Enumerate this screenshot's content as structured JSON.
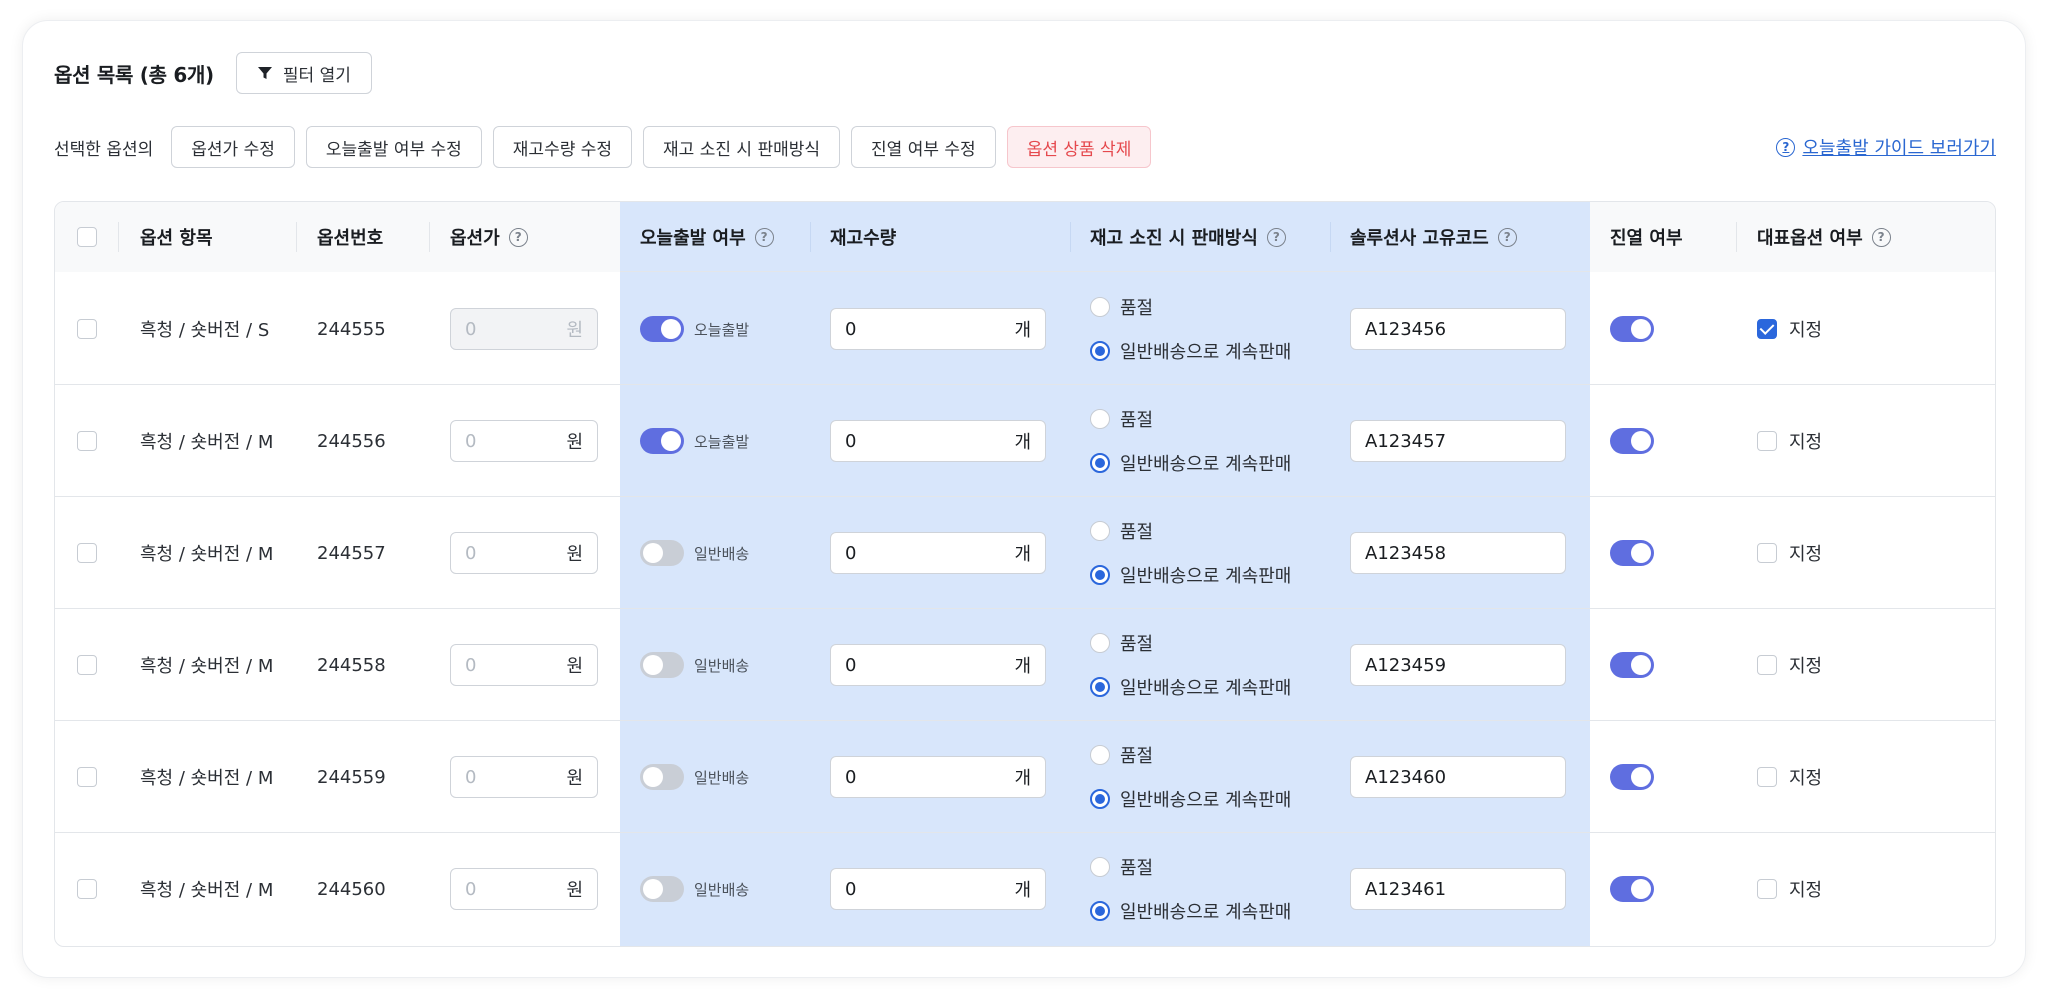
{
  "header": {
    "title": "옵션 목록 (총 6개)",
    "filter_button": "필터 열기",
    "filter_icon": "filter-icon"
  },
  "actions": {
    "label": "선택한 옵션의",
    "buttons": [
      "옵션가 수정",
      "오늘출발 여부 수정",
      "재고수량 수정",
      "재고 소진 시 판매방식",
      "진열 여부 수정"
    ],
    "delete_button": "옵션 상품 삭제",
    "guide_link": "오늘출발 가이드 보러가기",
    "guide_icon": "help-circle-icon"
  },
  "colors": {
    "accent": "#2b67dc",
    "toggle_on": "#5f6ee0",
    "highlight": "#d8e6fb",
    "danger": "#e5484d"
  },
  "columns": {
    "item": "옵션 항목",
    "number": "옵션번호",
    "price": "옵션가",
    "today": "오늘출발 여부",
    "stock": "재고수량",
    "soldout_mode": "재고 소진 시 판매방식",
    "code": "솔루션사 고유코드",
    "display": "진열 여부",
    "representative": "대표옵션 여부"
  },
  "labels": {
    "price_placeholder": "0",
    "price_unit": "원",
    "stock_unit": "개",
    "soldout": "품절",
    "continue": "일반배송으로 계속판매",
    "rep": "지정"
  },
  "rows": [
    {
      "item": "흑청 / 숏버전 / S",
      "number": "244555",
      "price_disabled": true,
      "today_on": true,
      "today_label": "오늘출발",
      "stock": "0",
      "mode": "continue",
      "code": "A123456",
      "display_on": true,
      "rep_checked": true
    },
    {
      "item": "흑청 / 숏버전 / M",
      "number": "244556",
      "price_disabled": false,
      "today_on": true,
      "today_label": "오늘출발",
      "stock": "0",
      "mode": "continue",
      "code": "A123457",
      "display_on": true,
      "rep_checked": false
    },
    {
      "item": "흑청 / 숏버전 / M",
      "number": "244557",
      "price_disabled": false,
      "today_on": false,
      "today_label": "일반배송",
      "stock": "0",
      "mode": "continue",
      "code": "A123458",
      "display_on": true,
      "rep_checked": false
    },
    {
      "item": "흑청 / 숏버전 / M",
      "number": "244558",
      "price_disabled": false,
      "today_on": false,
      "today_label": "일반배송",
      "stock": "0",
      "mode": "continue",
      "code": "A123459",
      "display_on": true,
      "rep_checked": false
    },
    {
      "item": "흑청 / 숏버전 / M",
      "number": "244559",
      "price_disabled": false,
      "today_on": false,
      "today_label": "일반배송",
      "stock": "0",
      "mode": "continue",
      "code": "A123460",
      "display_on": true,
      "rep_checked": false
    },
    {
      "item": "흑청 / 숏버전 / M",
      "number": "244560",
      "price_disabled": false,
      "today_on": false,
      "today_label": "일반배송",
      "stock": "0",
      "mode": "continue",
      "code": "A123461",
      "display_on": true,
      "rep_checked": false
    }
  ]
}
